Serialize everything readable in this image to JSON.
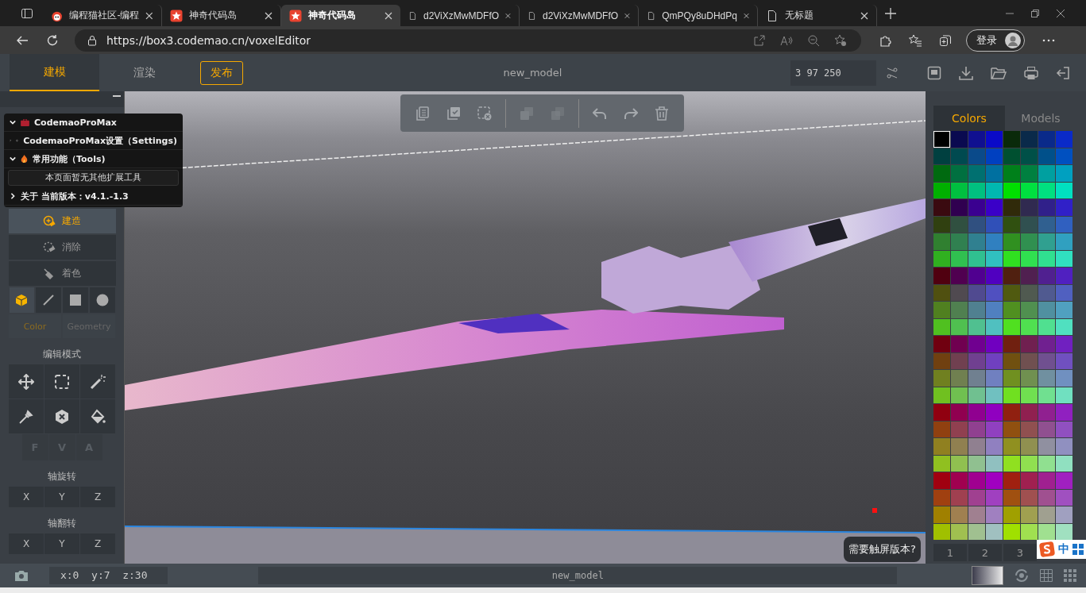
{
  "browser": {
    "tabs": [
      {
        "title": "编程猫社区-编程",
        "selected": false
      },
      {
        "title": "神奇代码岛",
        "selected": false
      },
      {
        "title": "神奇代码岛",
        "selected": true
      },
      {
        "title": "d2ViXzMwMDFfO",
        "selected": false
      },
      {
        "title": "d2ViXzMwMDFfO",
        "selected": false
      },
      {
        "title": "QmPQy8uDHdPq",
        "selected": false
      },
      {
        "title": "无标题",
        "selected": false
      }
    ],
    "address": "https://box3.codemao.cn/voxelEditor",
    "login": "登录"
  },
  "app": {
    "mode_tabs": [
      {
        "label": "建模",
        "selected": true
      },
      {
        "label": "渲染",
        "selected": false
      }
    ],
    "publish": "发布",
    "title": "new_model",
    "coords": "3 97 250"
  },
  "extension_panel": {
    "title": "CodemaoProMax",
    "expanded": true,
    "sections": [
      {
        "label": "CodemaoProMax设置（Settings)",
        "expanded": false
      },
      {
        "label": "常用功能（Tools)",
        "expanded": true,
        "note": "本页面暂无其他扩展工具"
      },
      {
        "label": "关于 当前版本：v4.1.-1.3",
        "expanded": false
      }
    ]
  },
  "tools": {
    "actions": [
      {
        "label": "建造",
        "kind": "build",
        "selected": true
      },
      {
        "label": "消除",
        "kind": "erase",
        "selected": false
      },
      {
        "label": "着色",
        "kind": "paint",
        "selected": false
      }
    ],
    "shapes": [
      {
        "kind": "cube",
        "selected": true
      },
      {
        "kind": "line",
        "selected": false
      },
      {
        "kind": "square",
        "selected": false
      },
      {
        "kind": "circle",
        "selected": false
      }
    ],
    "panel_tabs": [
      {
        "label": "Color",
        "selected": true
      },
      {
        "label": "Geometry",
        "selected": false
      }
    ],
    "edit_mode_label": "编辑模式",
    "faces": [
      {
        "label": "F",
        "disabled": true
      },
      {
        "label": "V",
        "disabled": true
      },
      {
        "label": "A",
        "disabled": true
      }
    ],
    "rotate": {
      "label": "轴旋转",
      "axes": [
        "X",
        "Y",
        "Z"
      ]
    },
    "flip": {
      "label": "轴翻转",
      "axes": [
        "X",
        "Y",
        "Z"
      ]
    }
  },
  "viewport": {
    "toolbar": [
      {
        "kind": "copy",
        "disabled": false
      },
      {
        "kind": "paste",
        "disabled": false
      },
      {
        "kind": "deselect",
        "disabled": false
      },
      {
        "kind": "merge",
        "disabled": true
      },
      {
        "kind": "subtract",
        "disabled": true
      },
      {
        "kind": "undo",
        "disabled": false
      },
      {
        "kind": "redo",
        "disabled": false
      },
      {
        "kind": "delete",
        "disabled": false
      }
    ],
    "hint": "需要触屏版本?"
  },
  "palette": {
    "tabs": [
      {
        "label": "Colors",
        "selected": true
      },
      {
        "label": "Models",
        "selected": false
      }
    ],
    "rows": [
      {
        "swatches": [
          {
            "color": "#000000",
            "selected": true
          },
          {
            "color": "#0a0a50",
            "selected": false
          },
          {
            "color": "#101090",
            "selected": false
          },
          {
            "color": "#0a0ac8",
            "selected": false
          },
          {
            "color": "#0a2a0a",
            "selected": false
          },
          {
            "color": "#0a2a4a",
            "selected": false
          },
          {
            "color": "#0a2a8a",
            "selected": false
          },
          {
            "color": "#0a2ac8",
            "selected": false
          }
        ]
      },
      {
        "swatches": [
          {
            "color": "#004040",
            "selected": false
          },
          {
            "color": "#004a50",
            "selected": false
          },
          {
            "color": "#0a4a8a",
            "selected": false
          },
          {
            "color": "#0040c0",
            "selected": false
          },
          {
            "color": "#005030",
            "selected": false
          },
          {
            "color": "#005048",
            "selected": false
          },
          {
            "color": "#00508a",
            "selected": false
          },
          {
            "color": "#0050c0",
            "selected": false
          }
        ]
      },
      {
        "swatches": [
          {
            "color": "#006a10",
            "selected": false
          },
          {
            "color": "#007040",
            "selected": false
          },
          {
            "color": "#007070",
            "selected": false
          },
          {
            "color": "#0070a0",
            "selected": false
          },
          {
            "color": "#00801a",
            "selected": false
          },
          {
            "color": "#008040",
            "selected": false
          },
          {
            "color": "#00a0a0",
            "selected": false
          },
          {
            "color": "#00a0c0",
            "selected": false
          }
        ]
      },
      {
        "swatches": [
          {
            "color": "#00b000",
            "selected": false
          },
          {
            "color": "#00c040",
            "selected": false
          },
          {
            "color": "#00c080",
            "selected": false
          },
          {
            "color": "#00b8b0",
            "selected": false
          },
          {
            "color": "#00e000",
            "selected": false
          },
          {
            "color": "#00e040",
            "selected": false
          },
          {
            "color": "#00e080",
            "selected": false
          },
          {
            "color": "#00e0c0",
            "selected": false
          }
        ]
      },
      {
        "swatches": [
          {
            "color": "#3a0a10",
            "selected": false
          },
          {
            "color": "#300050",
            "selected": false
          },
          {
            "color": "#3a0090",
            "selected": false
          },
          {
            "color": "#3a00c8",
            "selected": false
          },
          {
            "color": "#302a0a",
            "selected": false
          },
          {
            "color": "#302a50",
            "selected": false
          },
          {
            "color": "#30208a",
            "selected": false
          },
          {
            "color": "#3020c8",
            "selected": false
          }
        ]
      },
      {
        "swatches": [
          {
            "color": "#304010",
            "selected": false
          },
          {
            "color": "#305040",
            "selected": false
          },
          {
            "color": "#305080",
            "selected": false
          },
          {
            "color": "#3050b8",
            "selected": false
          },
          {
            "color": "#305010",
            "selected": false
          },
          {
            "color": "#305050",
            "selected": false
          },
          {
            "color": "#306090",
            "selected": false
          },
          {
            "color": "#3060c0",
            "selected": false
          }
        ]
      },
      {
        "swatches": [
          {
            "color": "#308030",
            "selected": false
          },
          {
            "color": "#308050",
            "selected": false
          },
          {
            "color": "#308090",
            "selected": false
          },
          {
            "color": "#3080c0",
            "selected": false
          },
          {
            "color": "#309020",
            "selected": false
          },
          {
            "color": "#309050",
            "selected": false
          },
          {
            "color": "#30a090",
            "selected": false
          },
          {
            "color": "#30a0c0",
            "selected": false
          }
        ]
      },
      {
        "swatches": [
          {
            "color": "#30b020",
            "selected": false
          },
          {
            "color": "#30c050",
            "selected": false
          },
          {
            "color": "#30c090",
            "selected": false
          },
          {
            "color": "#30c0c0",
            "selected": false
          },
          {
            "color": "#30e020",
            "selected": false
          },
          {
            "color": "#30e050",
            "selected": false
          },
          {
            "color": "#30e090",
            "selected": false
          },
          {
            "color": "#30e0c0",
            "selected": false
          }
        ]
      },
      {
        "swatches": [
          {
            "color": "#500010",
            "selected": false
          },
          {
            "color": "#500050",
            "selected": false
          },
          {
            "color": "#500090",
            "selected": false
          },
          {
            "color": "#5000c0",
            "selected": false
          },
          {
            "color": "#502010",
            "selected": false
          },
          {
            "color": "#502050",
            "selected": false
          },
          {
            "color": "#502090",
            "selected": false
          },
          {
            "color": "#5020c0",
            "selected": false
          }
        ]
      },
      {
        "swatches": [
          {
            "color": "#505010",
            "selected": false
          },
          {
            "color": "#504a50",
            "selected": false
          },
          {
            "color": "#504a90",
            "selected": false
          },
          {
            "color": "#5050c0",
            "selected": false
          },
          {
            "color": "#505a10",
            "selected": false
          },
          {
            "color": "#505a50",
            "selected": false
          },
          {
            "color": "#505a90",
            "selected": false
          },
          {
            "color": "#5060c0",
            "selected": false
          }
        ]
      },
      {
        "swatches": [
          {
            "color": "#508020",
            "selected": false
          },
          {
            "color": "#508050",
            "selected": false
          },
          {
            "color": "#508090",
            "selected": false
          },
          {
            "color": "#5080c0",
            "selected": false
          },
          {
            "color": "#509020",
            "selected": false
          },
          {
            "color": "#509050",
            "selected": false
          },
          {
            "color": "#5090a0",
            "selected": false
          },
          {
            "color": "#50a0c0",
            "selected": false
          }
        ]
      },
      {
        "swatches": [
          {
            "color": "#50c020",
            "selected": false
          },
          {
            "color": "#50c050",
            "selected": false
          },
          {
            "color": "#50c090",
            "selected": false
          },
          {
            "color": "#50c0c0",
            "selected": false
          },
          {
            "color": "#50e020",
            "selected": false
          },
          {
            "color": "#50e050",
            "selected": false
          },
          {
            "color": "#50e090",
            "selected": false
          },
          {
            "color": "#50e0c0",
            "selected": false
          }
        ]
      },
      {
        "swatches": [
          {
            "color": "#700010",
            "selected": false
          },
          {
            "color": "#700050",
            "selected": false
          },
          {
            "color": "#700090",
            "selected": false
          },
          {
            "color": "#7000c0",
            "selected": false
          },
          {
            "color": "#702010",
            "selected": false
          },
          {
            "color": "#702050",
            "selected": false
          },
          {
            "color": "#702090",
            "selected": false
          },
          {
            "color": "#7020c0",
            "selected": false
          }
        ]
      },
      {
        "swatches": [
          {
            "color": "#704010",
            "selected": false
          },
          {
            "color": "#704050",
            "selected": false
          },
          {
            "color": "#704090",
            "selected": false
          },
          {
            "color": "#7040c0",
            "selected": false
          },
          {
            "color": "#705010",
            "selected": false
          },
          {
            "color": "#705050",
            "selected": false
          },
          {
            "color": "#705090",
            "selected": false
          },
          {
            "color": "#7050c0",
            "selected": false
          }
        ]
      },
      {
        "swatches": [
          {
            "color": "#708020",
            "selected": false
          },
          {
            "color": "#708050",
            "selected": false
          },
          {
            "color": "#708090",
            "selected": false
          },
          {
            "color": "#7080c0",
            "selected": false
          },
          {
            "color": "#709020",
            "selected": false
          },
          {
            "color": "#709050",
            "selected": false
          },
          {
            "color": "#7090a0",
            "selected": false
          },
          {
            "color": "#7090c0",
            "selected": false
          }
        ]
      },
      {
        "swatches": [
          {
            "color": "#70c020",
            "selected": false
          },
          {
            "color": "#70c050",
            "selected": false
          },
          {
            "color": "#70c090",
            "selected": false
          },
          {
            "color": "#70c0c0",
            "selected": false
          },
          {
            "color": "#70e020",
            "selected": false
          },
          {
            "color": "#70e050",
            "selected": false
          },
          {
            "color": "#70e090",
            "selected": false
          },
          {
            "color": "#70e0c0",
            "selected": false
          }
        ]
      },
      {
        "swatches": [
          {
            "color": "#900010",
            "selected": false
          },
          {
            "color": "#900050",
            "selected": false
          },
          {
            "color": "#900090",
            "selected": false
          },
          {
            "color": "#9000c0",
            "selected": false
          },
          {
            "color": "#902010",
            "selected": false
          },
          {
            "color": "#902050",
            "selected": false
          },
          {
            "color": "#902090",
            "selected": false
          },
          {
            "color": "#9020c0",
            "selected": false
          }
        ]
      },
      {
        "swatches": [
          {
            "color": "#904010",
            "selected": false
          },
          {
            "color": "#904050",
            "selected": false
          },
          {
            "color": "#904090",
            "selected": false
          },
          {
            "color": "#9040c0",
            "selected": false
          },
          {
            "color": "#905010",
            "selected": false
          },
          {
            "color": "#905050",
            "selected": false
          },
          {
            "color": "#905090",
            "selected": false
          },
          {
            "color": "#9050c0",
            "selected": false
          }
        ]
      },
      {
        "swatches": [
          {
            "color": "#908020",
            "selected": false
          },
          {
            "color": "#908050",
            "selected": false
          },
          {
            "color": "#908090",
            "selected": false
          },
          {
            "color": "#9080c0",
            "selected": false
          },
          {
            "color": "#909020",
            "selected": false
          },
          {
            "color": "#909050",
            "selected": false
          },
          {
            "color": "#9090a0",
            "selected": false
          },
          {
            "color": "#9090c0",
            "selected": false
          }
        ]
      },
      {
        "swatches": [
          {
            "color": "#90c020",
            "selected": false
          },
          {
            "color": "#90c050",
            "selected": false
          },
          {
            "color": "#90c090",
            "selected": false
          },
          {
            "color": "#90c0c0",
            "selected": false
          },
          {
            "color": "#90e020",
            "selected": false
          },
          {
            "color": "#90e050",
            "selected": false
          },
          {
            "color": "#90e090",
            "selected": false
          },
          {
            "color": "#90e0c0",
            "selected": false
          }
        ]
      },
      {
        "swatches": [
          {
            "color": "#a00010",
            "selected": false
          },
          {
            "color": "#a00050",
            "selected": false
          },
          {
            "color": "#a00090",
            "selected": false
          },
          {
            "color": "#a000c0",
            "selected": false
          },
          {
            "color": "#a02010",
            "selected": false
          },
          {
            "color": "#a02050",
            "selected": false
          },
          {
            "color": "#a02090",
            "selected": false
          },
          {
            "color": "#a020c0",
            "selected": false
          }
        ]
      },
      {
        "swatches": [
          {
            "color": "#a04010",
            "selected": false
          },
          {
            "color": "#a04050",
            "selected": false
          },
          {
            "color": "#a04090",
            "selected": false
          },
          {
            "color": "#a040c0",
            "selected": false
          },
          {
            "color": "#a05010",
            "selected": false
          },
          {
            "color": "#a05050",
            "selected": false
          },
          {
            "color": "#a05090",
            "selected": false
          },
          {
            "color": "#a050c0",
            "selected": false
          }
        ]
      },
      {
        "swatches": [
          {
            "color": "#a08000",
            "selected": false
          },
          {
            "color": "#a08050",
            "selected": false
          },
          {
            "color": "#a08090",
            "selected": false
          },
          {
            "color": "#a080c0",
            "selected": false
          },
          {
            "color": "#a0a000",
            "selected": false
          },
          {
            "color": "#a0a050",
            "selected": false
          },
          {
            "color": "#a0a090",
            "selected": false
          },
          {
            "color": "#a0a0c0",
            "selected": false
          }
        ]
      },
      {
        "swatches": [
          {
            "color": "#a0c000",
            "selected": false
          },
          {
            "color": "#a0c050",
            "selected": false
          },
          {
            "color": "#a0c090",
            "selected": false
          },
          {
            "color": "#a0c0c0",
            "selected": false
          },
          {
            "color": "#a0e000",
            "selected": false
          },
          {
            "color": "#a0e050",
            "selected": false
          },
          {
            "color": "#a0e090",
            "selected": false
          },
          {
            "color": "#a0e0c0",
            "selected": false
          }
        ]
      }
    ],
    "pages": [
      {
        "label": "1"
      },
      {
        "label": "2"
      },
      {
        "label": "3"
      }
    ]
  },
  "ime": {
    "label": "中"
  },
  "status": {
    "coords": "x:0  y:7  z:30",
    "model_name": "new_model"
  }
}
